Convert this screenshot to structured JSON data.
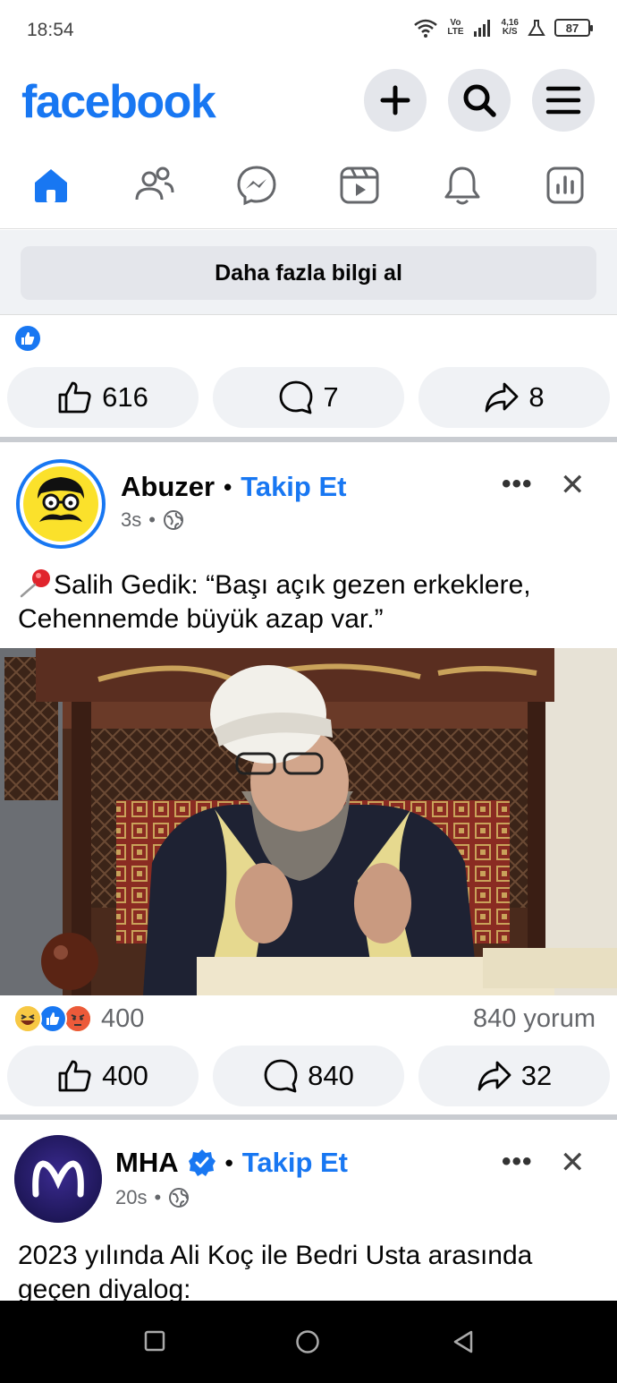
{
  "status_bar": {
    "time": "18:54",
    "network_label_top": "Vo",
    "network_label_bottom": "LTE",
    "speed_top": "4,16",
    "speed_bottom": "K/S",
    "battery": "87"
  },
  "header": {
    "logo": "facebook",
    "icons": [
      "plus-icon",
      "search-icon",
      "menu-icon"
    ]
  },
  "nav_tabs": [
    "home-icon",
    "friends-icon",
    "messenger-icon",
    "video-icon",
    "bell-icon",
    "dashboard-icon"
  ],
  "cta": {
    "label": "Daha fazla bilgi al"
  },
  "prev_post": {
    "likes": "616",
    "comments": "7",
    "shares": "8"
  },
  "post1": {
    "author": "Abuzer",
    "follow": "Takip Et",
    "time": "3s",
    "text": "Salih Gedik: “Başı açık gezen erkeklere, Cehennemde büyük azap var.”",
    "reaction_count": "400",
    "comment_count_label": "840 yorum",
    "likes": "400",
    "comments": "840",
    "shares": "32"
  },
  "post2": {
    "author": "MHA",
    "follow": "Takip Et",
    "time": "20s",
    "text": "2023 yılında Ali Koç ile Bedri Usta arasında geçen diyalog:"
  },
  "colors": {
    "brand": "#1877f2",
    "button_bg": "#e4e6eb",
    "muted": "#65676b"
  }
}
